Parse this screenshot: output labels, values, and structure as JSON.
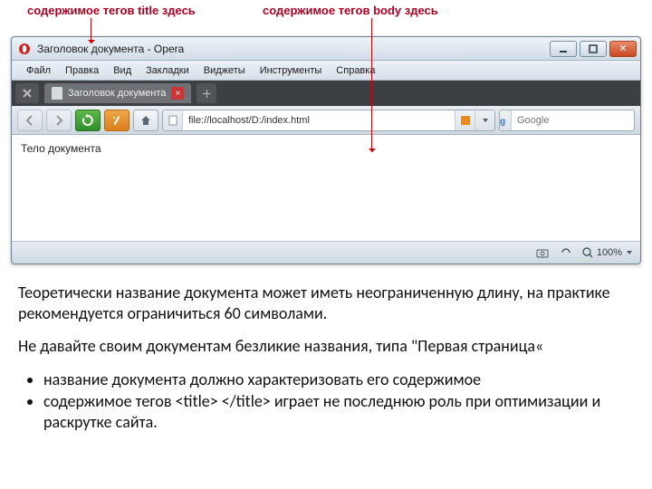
{
  "callouts": {
    "title": "содержимое тегов title здесь",
    "body": "содержимое тегов body здесь"
  },
  "window": {
    "title": "Заголовок документа - Opera"
  },
  "menu": {
    "file": "Файл",
    "edit": "Правка",
    "view": "Вид",
    "bookmarks": "Закладки",
    "widgets": "Виджеты",
    "tools": "Инструменты",
    "help": "Справка"
  },
  "tab": {
    "label": "Заголовок документа"
  },
  "addressbar": {
    "url": "file://localhost/D:/index.html"
  },
  "searchbox": {
    "engine": "Google",
    "placeholder": "Google"
  },
  "page": {
    "body_text": "Тело документа"
  },
  "status": {
    "zoom": "100%"
  },
  "article": {
    "p1": "Теоретически название документа может иметь неограниченную длину, на практике рекомендуется ограничиться 60 символами.",
    "p2": "Не давайте своим документам безликие названия, типа \"Первая страница«",
    "li1": "название документа должно характеризовать его содержимое",
    "li2": "содержимое тегов <title> </title> играет не последнюю роль при оптимизации и раскрутке сайта."
  }
}
